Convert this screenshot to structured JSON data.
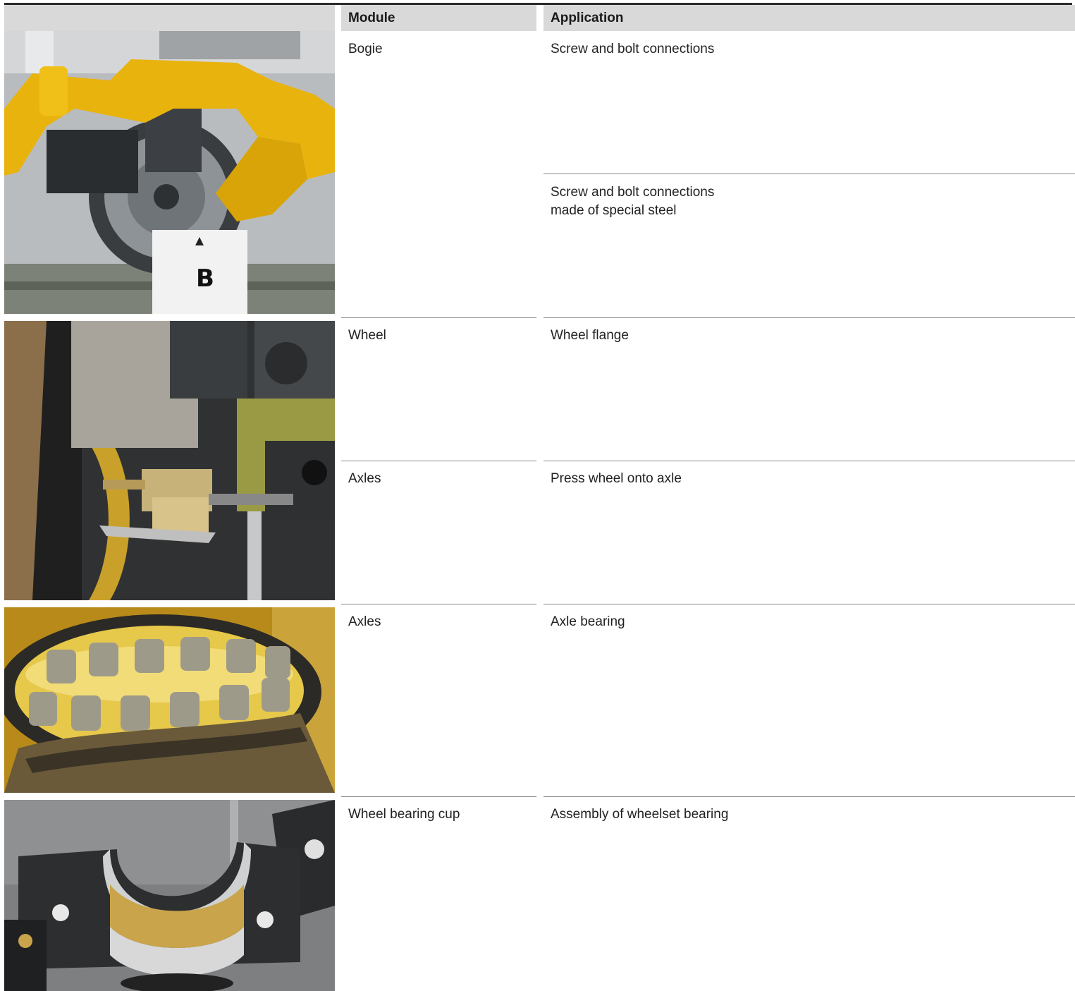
{
  "table": {
    "headers": {
      "module": "Module",
      "application": "Application"
    },
    "rows": [
      {
        "module": "Bogie",
        "application": "Screw and bolt connections"
      },
      {
        "module": "",
        "application": "Screw and bolt connections",
        "application_line2": "made of special steel"
      },
      {
        "module": "Wheel",
        "application": "Wheel flange"
      },
      {
        "module": "Axles",
        "application": "Press wheel onto axle"
      },
      {
        "module": "Axles",
        "application": "Axle bearing"
      },
      {
        "module": "Wheel bearing cup",
        "application": "Assembly of wheelset bearing"
      }
    ]
  },
  "photos": {
    "bogie_sign": "B"
  }
}
